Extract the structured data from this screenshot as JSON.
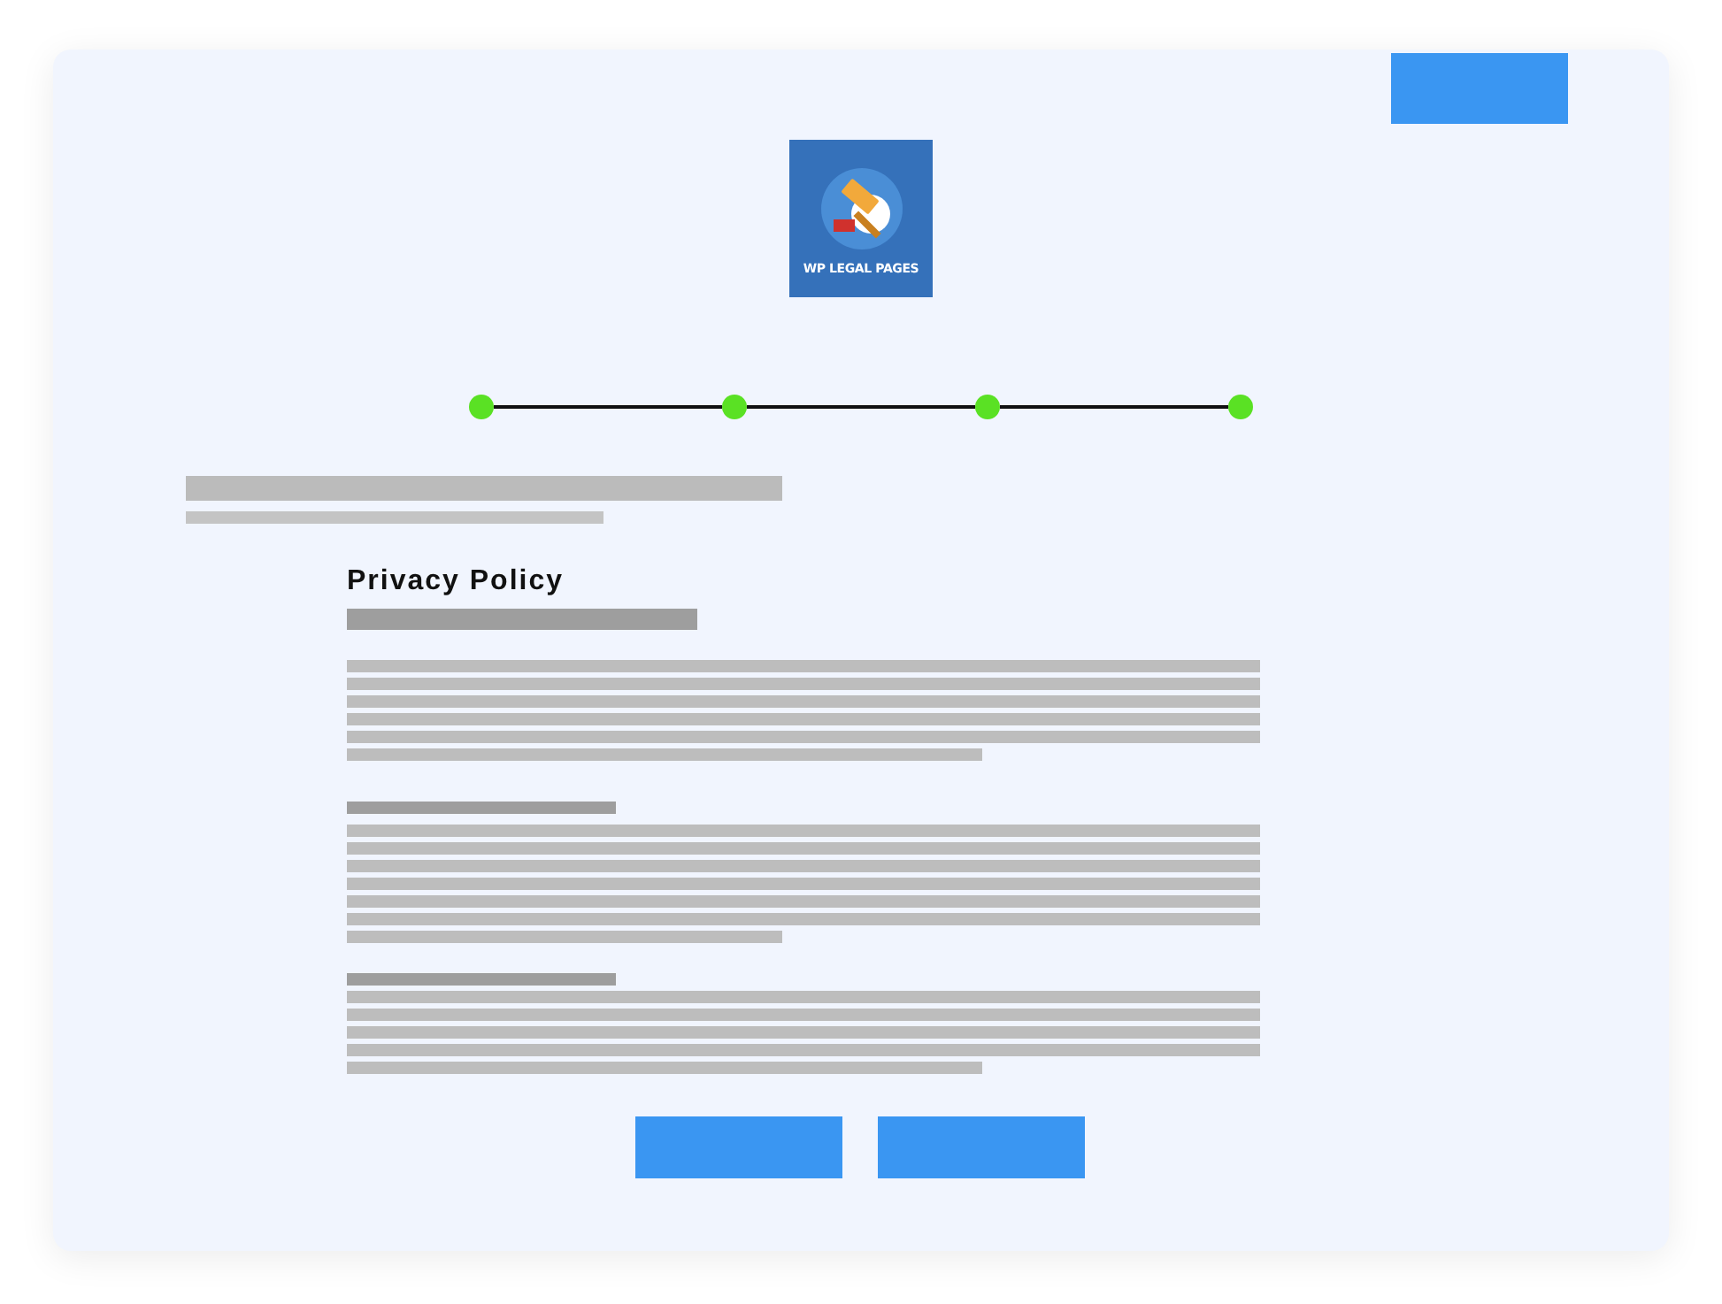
{
  "logo": {
    "text": "WP LEGAL PAGES"
  },
  "steps": [
    {
      "done": true
    },
    {
      "done": true
    },
    {
      "done": true
    },
    {
      "done": true
    }
  ],
  "document": {
    "title": "Privacy Policy"
  }
}
